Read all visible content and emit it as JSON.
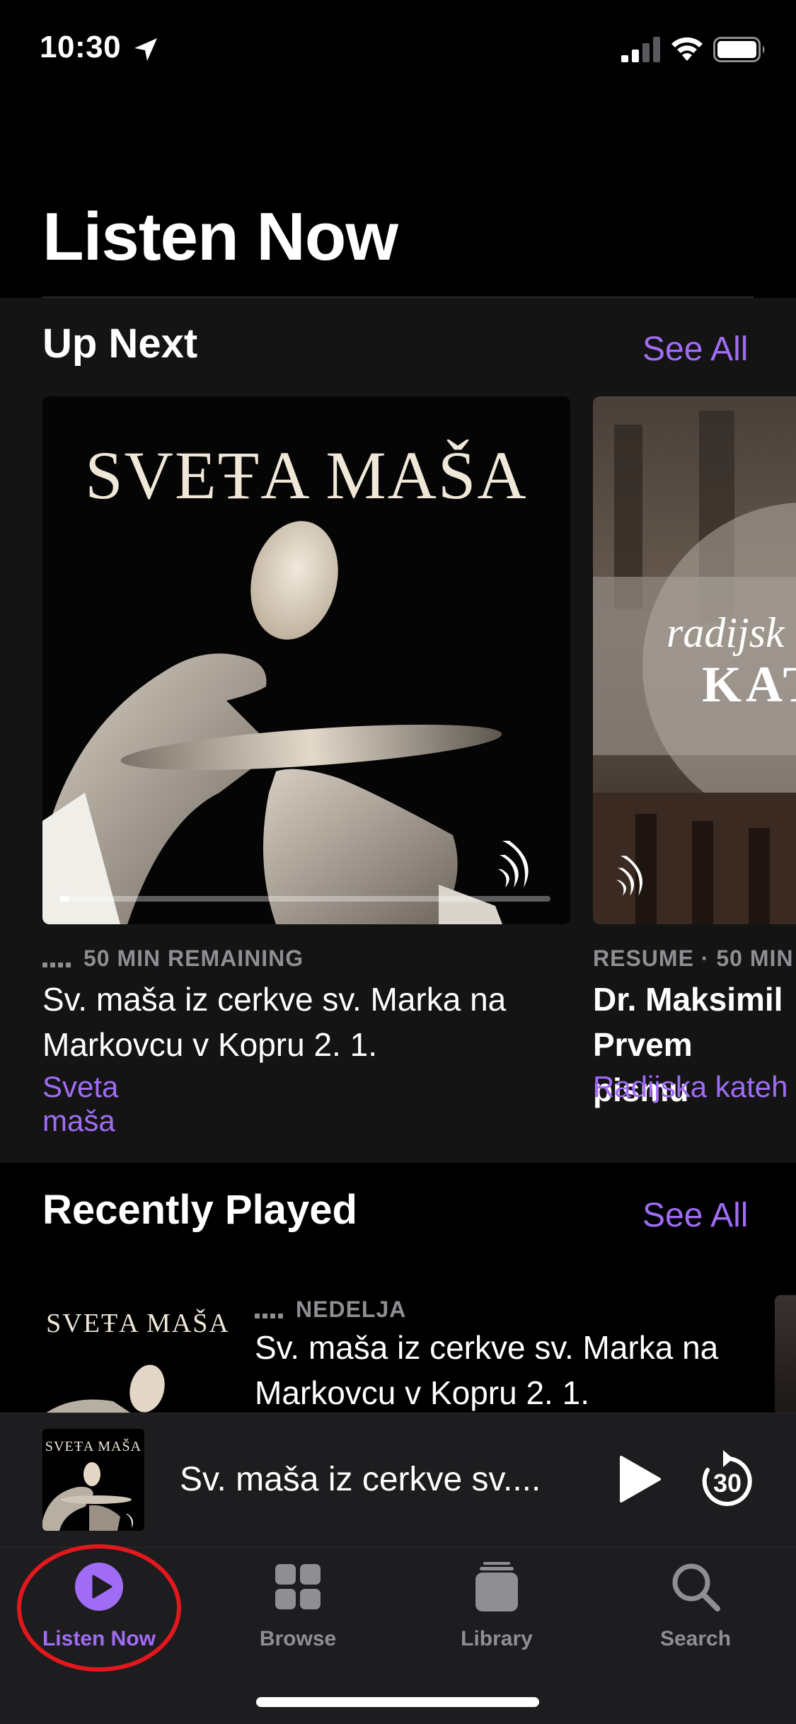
{
  "status_bar": {
    "time": "10:30"
  },
  "header": {
    "title": "Listen Now"
  },
  "up_next": {
    "title": "Up Next",
    "see_all": "See All",
    "cards": [
      {
        "art_title": "SVEŦA MAŠA",
        "meta": "50 MIN REMAINING",
        "episode": "Sv. maša iz cerkve sv. Marka na Markovcu v Kopru 2. 1.",
        "show": "Sveta maša",
        "progress": 0.02
      },
      {
        "art_title_line1": "radijsk",
        "art_title_line2": "KAT",
        "meta": "RESUME · 50 MIN",
        "episode": "Dr. Maksimil Prvem pismu",
        "show": "Radijska kateh"
      }
    ]
  },
  "recently_played": {
    "title": "Recently Played",
    "see_all": "See All",
    "items": [
      {
        "art_title": "SVEŦA MAŠA",
        "meta": "NEDELJA",
        "episode": "Sv. maša iz cerkve sv. Marka na Markovcu v Kopru 2. 1."
      }
    ]
  },
  "mini_player": {
    "art_title": "SVEŦA MAŠA",
    "title": "Sv. maša iz cerkve sv....",
    "skip_seconds": "30"
  },
  "tabs": [
    {
      "label": "Listen Now",
      "icon": "play-circle-icon",
      "active": true
    },
    {
      "label": "Browse",
      "icon": "grid-icon",
      "active": false
    },
    {
      "label": "Library",
      "icon": "library-stack-icon",
      "active": false
    },
    {
      "label": "Search",
      "icon": "search-icon",
      "active": false
    }
  ],
  "colors": {
    "accent": "#a06cf5",
    "background": "#000000",
    "secondary_text": "#8e8e93",
    "annotation": "#e3171c"
  }
}
